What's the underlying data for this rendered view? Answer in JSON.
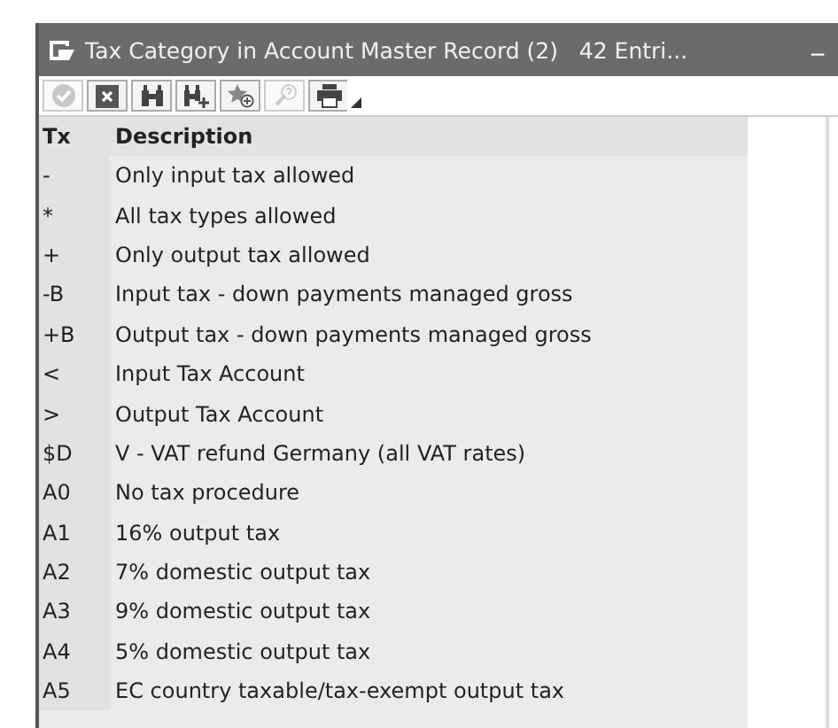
{
  "window": {
    "title": "Tax Category in Account Master Record (2)   42 Entri...",
    "minimize": "_"
  },
  "toolbar": [
    {
      "kind": "check",
      "disabled": true
    },
    {
      "kind": "cancel",
      "disabled": false
    },
    {
      "kind": "find",
      "disabled": false
    },
    {
      "kind": "find-next",
      "disabled": false
    },
    {
      "kind": "favorite",
      "disabled": false
    },
    {
      "kind": "help",
      "disabled": true
    },
    {
      "kind": "print",
      "disabled": false
    }
  ],
  "table": {
    "columns": [
      "Tx",
      "Description"
    ],
    "rows": [
      [
        "-",
        "Only input tax allowed"
      ],
      [
        "*",
        "All tax types allowed"
      ],
      [
        "+",
        "Only output tax allowed"
      ],
      [
        "-B",
        "Input tax - down payments managed gross"
      ],
      [
        "+B",
        "Output tax - down payments managed gross"
      ],
      [
        "<",
        "Input Tax Account"
      ],
      [
        ">",
        "Output Tax Account"
      ],
      [
        "$D",
        "V - VAT refund Germany (all VAT rates)"
      ],
      [
        "A0",
        "No tax procedure"
      ],
      [
        "A1",
        "16% output tax"
      ],
      [
        "A2",
        "7% domestic output tax"
      ],
      [
        "A3",
        "9% domestic output tax"
      ],
      [
        "A4",
        "5% domestic output tax"
      ],
      [
        "A5",
        "EC country taxable/tax-exempt output tax"
      ]
    ]
  }
}
